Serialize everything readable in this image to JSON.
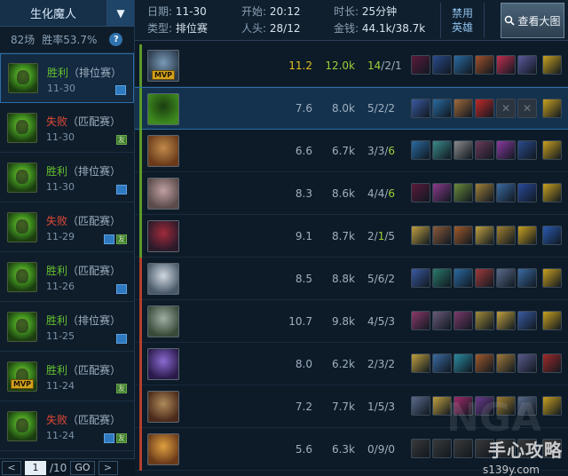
{
  "sidebar": {
    "champion_name": "生化魔人",
    "toggle_glyph": "▼",
    "stats": {
      "games": "82场",
      "win_rate": "胜率53.7%",
      "help": "?"
    },
    "matches": [
      {
        "result": "胜利",
        "type": "（排位赛）",
        "date": "11-30",
        "win": true,
        "mvp": false,
        "flags": [
          "shot"
        ],
        "selected": true
      },
      {
        "result": "失败",
        "type": "（匹配赛）",
        "date": "11-30",
        "win": false,
        "mvp": false,
        "flags": [
          "friend"
        ]
      },
      {
        "result": "胜利",
        "type": "（排位赛）",
        "date": "11-30",
        "win": true,
        "mvp": false,
        "flags": [
          "shot"
        ]
      },
      {
        "result": "失败",
        "type": "（匹配赛）",
        "date": "11-29",
        "win": false,
        "mvp": false,
        "flags": [
          "shot",
          "friend"
        ]
      },
      {
        "result": "胜利",
        "type": "（匹配赛）",
        "date": "11-26",
        "win": true,
        "mvp": false,
        "flags": [
          "shot"
        ]
      },
      {
        "result": "胜利",
        "type": "（排位赛）",
        "date": "11-25",
        "win": true,
        "mvp": false,
        "flags": [
          "shot"
        ]
      },
      {
        "result": "胜利",
        "type": "（匹配赛）",
        "date": "11-24",
        "win": true,
        "mvp": true,
        "flags": [
          "friend"
        ]
      },
      {
        "result": "失败",
        "type": "（匹配赛）",
        "date": "11-24",
        "win": false,
        "mvp": false,
        "flags": [
          "shot",
          "friend"
        ]
      }
    ],
    "friend_flag": "友",
    "mvp_label": "MVP",
    "pager": {
      "prev": "<",
      "current": "1",
      "total": "/10",
      "go": "GO",
      "next": ">"
    }
  },
  "header": {
    "date_label": "日期:",
    "date": "11-30",
    "start_label": "开始:",
    "start": "20:12",
    "duration_label": "时长:",
    "duration": "25分钟",
    "type_label": "类型:",
    "type": "排位赛",
    "kills_label": "人头:",
    "kills": "28/12",
    "gold_label": "金钱:",
    "gold": "44.1k/38.7k",
    "ban_line1": "禁用",
    "ban_line2": "英雄",
    "view_map": "查看大图",
    "view_map_icon": "magnifier-icon"
  },
  "team_colors": {
    "blue": "#5b9a2a",
    "red": "#b2402c",
    "selected": "#2d6ea6",
    "kda_highlight": "#9bd03a"
  },
  "players": [
    {
      "team": "blue",
      "score": "11.2",
      "gold": "12.0k",
      "kda": [
        "14",
        "2",
        "1"
      ],
      "hl": [
        0
      ],
      "mvp": true,
      "highlight_stats": true,
      "portrait": [
        "#2a3a4a",
        "#7a9ab8"
      ],
      "items": [
        "#5a1a3a",
        "#2a4a8a",
        "#2a6aa0",
        "#a0502a",
        "#c03050",
        "#5a5a9a",
        "#c8a020"
      ]
    },
    {
      "team": "blue",
      "score": "7.6",
      "gold": "8.0k",
      "kda": [
        "5",
        "2",
        "2"
      ],
      "hl": [],
      "mvp": false,
      "selected": true,
      "portrait": [
        "#3d8a1e",
        "#1b3d10"
      ],
      "items": [
        "#3a5aa0",
        "#2a6aa0",
        "#a06a3a",
        "#c02a2a",
        "empty",
        "empty",
        "#c8a020"
      ]
    },
    {
      "team": "blue",
      "score": "6.6",
      "gold": "6.7k",
      "kda": [
        "3",
        "3",
        "6"
      ],
      "hl": [
        2
      ],
      "mvp": false,
      "portrait": [
        "#6a3a1a",
        "#c08a4a"
      ],
      "items": [
        "#2a6aa0",
        "#3a8a8a",
        "#8a8a8a",
        "#6a3a5a",
        "#8a3aa0",
        "#2a4a8a",
        "#c8a020"
      ]
    },
    {
      "team": "blue",
      "score": "8.3",
      "gold": "8.6k",
      "kda": [
        "4",
        "4",
        "6"
      ],
      "hl": [
        2
      ],
      "mvp": false,
      "portrait": [
        "#5a4a4a",
        "#c0a0a0"
      ],
      "items": [
        "#5a1a3a",
        "#8a3a8a",
        "#6a8a3a",
        "#a0803a",
        "#3a6aa0",
        "#2a4a9a",
        "#c8a020"
      ]
    },
    {
      "team": "blue",
      "score": "9.1",
      "gold": "8.7k",
      "kda": [
        "2",
        "1",
        "5"
      ],
      "hl": [
        1
      ],
      "mvp": false,
      "portrait": [
        "#2a1a2a",
        "#a02a3a"
      ],
      "items": [
        "#c0a040",
        "#8a5a3a",
        "#a05a2a",
        "#c0a040",
        "#a08030",
        "#c8a020",
        "#2a5ab0"
      ]
    },
    {
      "team": "red",
      "score": "8.5",
      "gold": "8.8k",
      "kda": [
        "5",
        "6",
        "2"
      ],
      "hl": [],
      "mvp": false,
      "portrait": [
        "#4a5a6a",
        "#d0d8e0"
      ],
      "items": [
        "#3a5aa0",
        "#2a7a6a",
        "#2a6aa0",
        "#a03a3a",
        "#5a6a8a",
        "#3a6aa0",
        "#c8a020"
      ]
    },
    {
      "team": "red",
      "score": "10.7",
      "gold": "9.8k",
      "kda": [
        "4",
        "5",
        "3"
      ],
      "hl": [],
      "mvp": false,
      "portrait": [
        "#3a4a3a",
        "#a0b0a0"
      ],
      "items": [
        "#8a3a6a",
        "#6a5a7a",
        "#7a3a6a",
        "#a08a3a",
        "#c0a040",
        "#3a5aa0",
        "#c8a020"
      ]
    },
    {
      "team": "red",
      "score": "8.0",
      "gold": "6.2k",
      "kda": [
        "2",
        "3",
        "2"
      ],
      "hl": [],
      "mvp": false,
      "portrait": [
        "#2a1a4a",
        "#8a6ad0"
      ],
      "items": [
        "#c0a040",
        "#3a6aa0",
        "#2a8aa0",
        "#a05a2a",
        "#a07a3a",
        "#5a5a8a",
        "#a02a2a"
      ]
    },
    {
      "team": "red",
      "score": "7.2",
      "gold": "7.7k",
      "kda": [
        "1",
        "5",
        "3"
      ],
      "hl": [],
      "mvp": false,
      "portrait": [
        "#4a2a1a",
        "#b08a5a"
      ],
      "items": [
        "#5a6a8a",
        "#c0a040",
        "#a02a6a",
        "#6a3a8a",
        "#a08030",
        "#5a6a8a",
        "#c8a020"
      ]
    },
    {
      "team": "red",
      "score": "5.6",
      "gold": "6.3k",
      "kda": [
        "0",
        "9",
        "0"
      ],
      "hl": [],
      "mvp": false,
      "portrait": [
        "#6a3a1a",
        "#e0a040"
      ],
      "items": [
        "#3a3a3a",
        "#3a3a3a",
        "#3a3a3a",
        "#3a3a3a",
        "#3a3a3a",
        "#3a3a3a",
        "#3a3a3a"
      ]
    }
  ],
  "watermark": {
    "nga": "NGA",
    "site": "手心攻略",
    "url": "s139y.com"
  }
}
